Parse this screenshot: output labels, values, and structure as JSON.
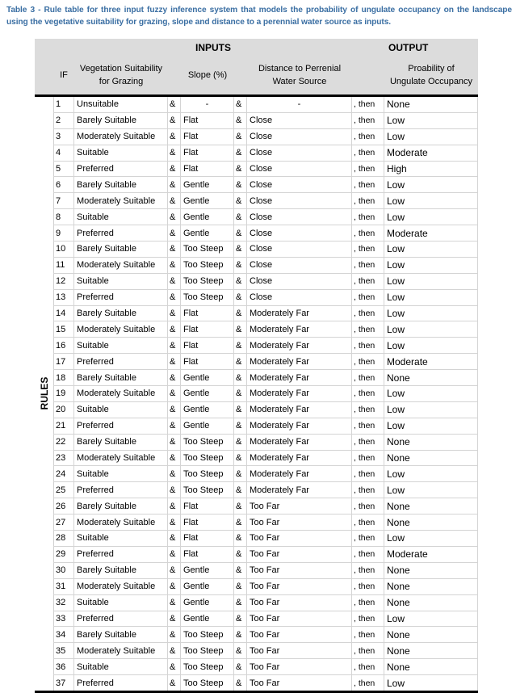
{
  "caption": "Table 3 - Rule table for three input fuzzy inference system that models the probability of ungulate occupancy on the landscape using the vegetative suitability for grazing, slope and distance to a perennial water source as inputs.",
  "header": {
    "inputs_label": "INPUTS",
    "output_label": "OUTPUT",
    "if_label": "IF",
    "veg_label_line1": "Vegetation Suitability",
    "veg_label_line2": "for Grazing",
    "slope_label": "Slope (%)",
    "dist_label_line1": "Distance to Perrenial",
    "dist_label_line2": "Water Source",
    "out_label_line1": "Proability of",
    "out_label_line2": "Ungulate Occupancy"
  },
  "rules_label": "RULES",
  "connector_and": "&",
  "connector_then": ", then",
  "rules": [
    {
      "n": "1",
      "veg": "Unsuitable",
      "slope": "-",
      "dist": "-",
      "out": "None"
    },
    {
      "n": "2",
      "veg": "Barely Suitable",
      "slope": "Flat",
      "dist": "Close",
      "out": "Low"
    },
    {
      "n": "3",
      "veg": "Moderately Suitable",
      "slope": "Flat",
      "dist": "Close",
      "out": "Low"
    },
    {
      "n": "4",
      "veg": "Suitable",
      "slope": "Flat",
      "dist": "Close",
      "out": "Moderate"
    },
    {
      "n": "5",
      "veg": "Preferred",
      "slope": "Flat",
      "dist": "Close",
      "out": "High"
    },
    {
      "n": "6",
      "veg": "Barely Suitable",
      "slope": "Gentle",
      "dist": "Close",
      "out": "Low"
    },
    {
      "n": "7",
      "veg": "Moderately Suitable",
      "slope": "Gentle",
      "dist": "Close",
      "out": "Low"
    },
    {
      "n": "8",
      "veg": "Suitable",
      "slope": "Gentle",
      "dist": "Close",
      "out": "Low"
    },
    {
      "n": "9",
      "veg": "Preferred",
      "slope": "Gentle",
      "dist": "Close",
      "out": "Moderate"
    },
    {
      "n": "10",
      "veg": "Barely Suitable",
      "slope": "Too Steep",
      "dist": "Close",
      "out": "Low"
    },
    {
      "n": "11",
      "veg": "Moderately Suitable",
      "slope": "Too Steep",
      "dist": "Close",
      "out": "Low"
    },
    {
      "n": "12",
      "veg": "Suitable",
      "slope": "Too Steep",
      "dist": "Close",
      "out": "Low"
    },
    {
      "n": "13",
      "veg": "Preferred",
      "slope": "Too Steep",
      "dist": "Close",
      "out": "Low"
    },
    {
      "n": "14",
      "veg": "Barely Suitable",
      "slope": "Flat",
      "dist": "Moderately Far",
      "out": "Low"
    },
    {
      "n": "15",
      "veg": "Moderately Suitable",
      "slope": "Flat",
      "dist": "Moderately Far",
      "out": "Low"
    },
    {
      "n": "16",
      "veg": "Suitable",
      "slope": "Flat",
      "dist": "Moderately Far",
      "out": "Low"
    },
    {
      "n": "17",
      "veg": "Preferred",
      "slope": "Flat",
      "dist": "Moderately Far",
      "out": "Moderate"
    },
    {
      "n": "18",
      "veg": "Barely Suitable",
      "slope": "Gentle",
      "dist": "Moderately Far",
      "out": "None"
    },
    {
      "n": "19",
      "veg": "Moderately Suitable",
      "slope": "Gentle",
      "dist": "Moderately Far",
      "out": "Low"
    },
    {
      "n": "20",
      "veg": "Suitable",
      "slope": "Gentle",
      "dist": "Moderately Far",
      "out": "Low"
    },
    {
      "n": "21",
      "veg": "Preferred",
      "slope": "Gentle",
      "dist": "Moderately Far",
      "out": "Low"
    },
    {
      "n": "22",
      "veg": "Barely Suitable",
      "slope": "Too Steep",
      "dist": "Moderately Far",
      "out": "None"
    },
    {
      "n": "23",
      "veg": "Moderately Suitable",
      "slope": "Too Steep",
      "dist": "Moderately Far",
      "out": "None"
    },
    {
      "n": "24",
      "veg": "Suitable",
      "slope": "Too Steep",
      "dist": "Moderately Far",
      "out": "Low"
    },
    {
      "n": "25",
      "veg": "Preferred",
      "slope": "Too Steep",
      "dist": "Moderately Far",
      "out": "Low"
    },
    {
      "n": "26",
      "veg": "Barely Suitable",
      "slope": "Flat",
      "dist": "Too Far",
      "out": "None"
    },
    {
      "n": "27",
      "veg": "Moderately Suitable",
      "slope": "Flat",
      "dist": "Too Far",
      "out": "None"
    },
    {
      "n": "28",
      "veg": "Suitable",
      "slope": "Flat",
      "dist": "Too Far",
      "out": "Low"
    },
    {
      "n": "29",
      "veg": "Preferred",
      "slope": "Flat",
      "dist": "Too Far",
      "out": "Moderate"
    },
    {
      "n": "30",
      "veg": "Barely Suitable",
      "slope": "Gentle",
      "dist": "Too Far",
      "out": "None"
    },
    {
      "n": "31",
      "veg": "Moderately Suitable",
      "slope": "Gentle",
      "dist": "Too Far",
      "out": "None"
    },
    {
      "n": "32",
      "veg": "Suitable",
      "slope": "Gentle",
      "dist": "Too Far",
      "out": "None"
    },
    {
      "n": "33",
      "veg": "Preferred",
      "slope": "Gentle",
      "dist": "Too Far",
      "out": "Low"
    },
    {
      "n": "34",
      "veg": "Barely Suitable",
      "slope": "Too Steep",
      "dist": "Too Far",
      "out": "None"
    },
    {
      "n": "35",
      "veg": "Moderately Suitable",
      "slope": "Too Steep",
      "dist": "Too Far",
      "out": "None"
    },
    {
      "n": "36",
      "veg": "Suitable",
      "slope": "Too Steep",
      "dist": "Too Far",
      "out": "None"
    },
    {
      "n": "37",
      "veg": "Preferred",
      "slope": "Too Steep",
      "dist": "Too Far",
      "out": "Low"
    }
  ]
}
